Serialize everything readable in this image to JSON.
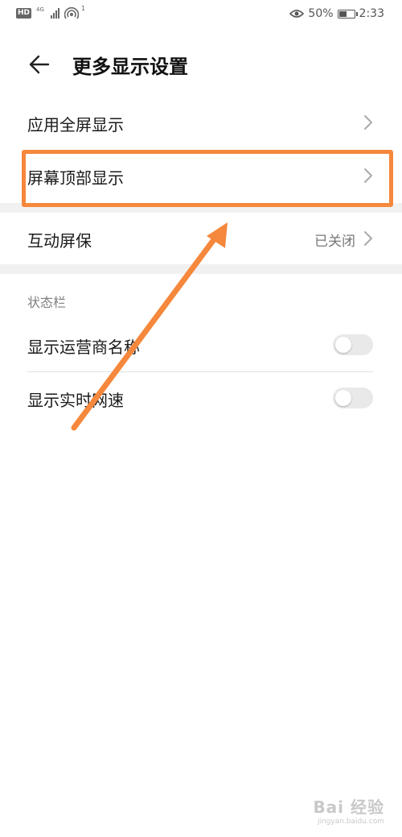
{
  "status_bar": {
    "hd_badge": "HD",
    "network_type": "4G",
    "wifi_sup": "1",
    "battery_percent_text": "50%",
    "battery_level": 0.5,
    "time": "2:33",
    "icons": [
      "hd-icon",
      "signal-icon",
      "wifi-hotspot-icon",
      "eye-comfort-icon",
      "battery-icon"
    ]
  },
  "header": {
    "title": "更多显示设置",
    "back_icon": "arrow-left-icon"
  },
  "settings": {
    "items": [
      {
        "label": "应用全屏显示"
      },
      {
        "label": "屏幕顶部显示"
      },
      {
        "label": "互动屏保",
        "value": "已关闭"
      }
    ]
  },
  "status_section": {
    "title": "状态栏",
    "toggles": [
      {
        "label": "显示运营商名称",
        "on": false
      },
      {
        "label": "显示实时网速",
        "on": false
      }
    ]
  },
  "annotation": {
    "color": "#f5883c"
  },
  "watermark": {
    "logo": "Bai 经验",
    "url": "jingyan.baidu.com"
  }
}
